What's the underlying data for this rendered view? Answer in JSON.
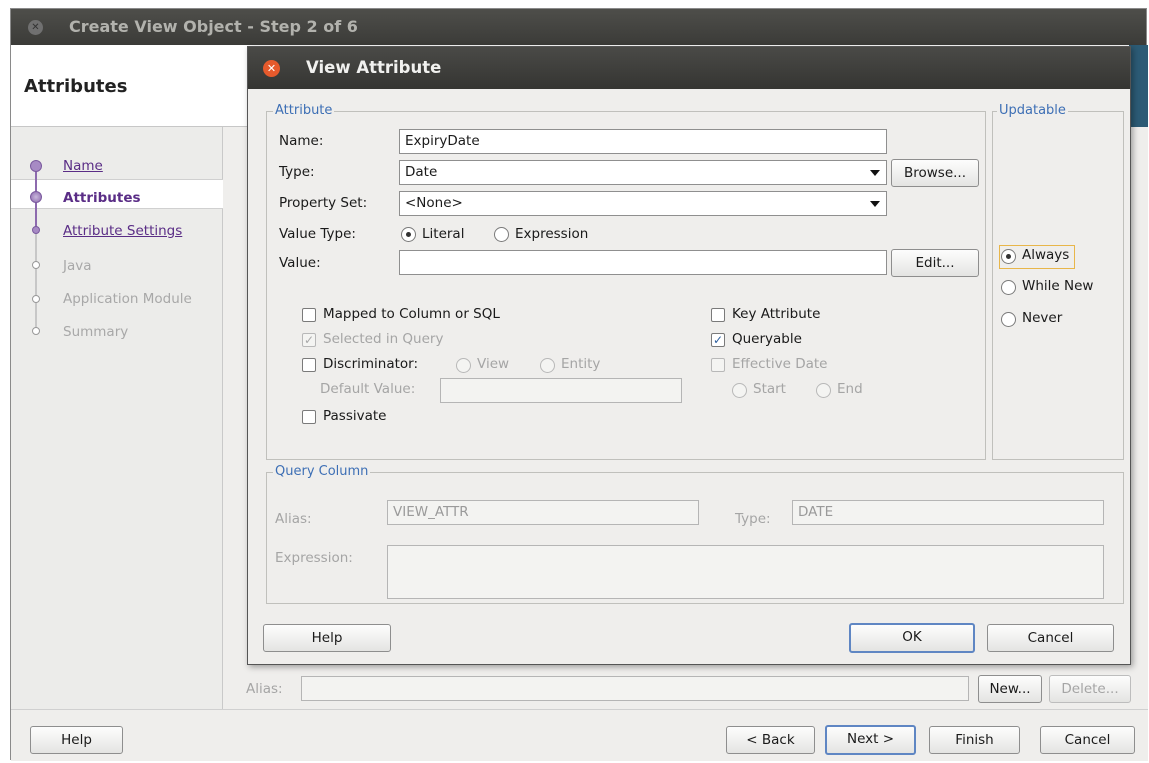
{
  "wizard": {
    "title": "Create View Object - Step 2 of 6",
    "header": "Attributes",
    "steps": [
      {
        "label": "Name",
        "state": "done"
      },
      {
        "label": "Attributes",
        "state": "current"
      },
      {
        "label": "Attribute Settings",
        "state": "link"
      },
      {
        "label": "Java",
        "state": "disabled"
      },
      {
        "label": "Application Module",
        "state": "disabled"
      },
      {
        "label": "Summary",
        "state": "disabled"
      }
    ],
    "alias_label": "Alias:",
    "new_button": "New...",
    "delete_button": "Delete...",
    "help_button": "Help",
    "back_button": "< Back",
    "next_button": "Next >",
    "finish_button": "Finish",
    "cancel_button": "Cancel"
  },
  "dialog": {
    "title": "View Attribute",
    "attribute_group": "Attribute",
    "name_label": "Name:",
    "name_value": "ExpiryDate",
    "type_label": "Type:",
    "type_value": "Date",
    "browse_button": "Browse...",
    "property_set_label": "Property Set:",
    "property_set_value": "<None>",
    "value_type_label": "Value Type:",
    "value_type_literal": "Literal",
    "value_type_expression": "Expression",
    "value_type_selected": "Literal",
    "value_label": "Value:",
    "value_value": "",
    "edit_button": "Edit...",
    "mapped_label": "Mapped to Column or SQL",
    "mapped_checked": false,
    "selected_in_query_label": "Selected in Query",
    "selected_in_query_checked": true,
    "discriminator_label": "Discriminator:",
    "discriminator_checked": false,
    "disc_view": "View",
    "disc_entity": "Entity",
    "default_value_label": "Default Value:",
    "passivate_label": "Passivate",
    "passivate_checked": false,
    "key_attribute_label": "Key Attribute",
    "key_attribute_checked": false,
    "queryable_label": "Queryable",
    "queryable_checked": true,
    "effective_date_label": "Effective Date",
    "effective_date_checked": false,
    "eff_start": "Start",
    "eff_end": "End",
    "updatable_group": "Updatable",
    "updatable_always": "Always",
    "updatable_while_new": "While New",
    "updatable_never": "Never",
    "updatable_selected": "Always",
    "query_column_group": "Query Column",
    "alias_label": "Alias:",
    "alias_value": "VIEW_ATTR",
    "qc_type_label": "Type:",
    "qc_type_value": "DATE",
    "expression_label": "Expression:",
    "expression_value": "",
    "help_button": "Help",
    "ok_button": "OK",
    "cancel_button": "Cancel"
  }
}
